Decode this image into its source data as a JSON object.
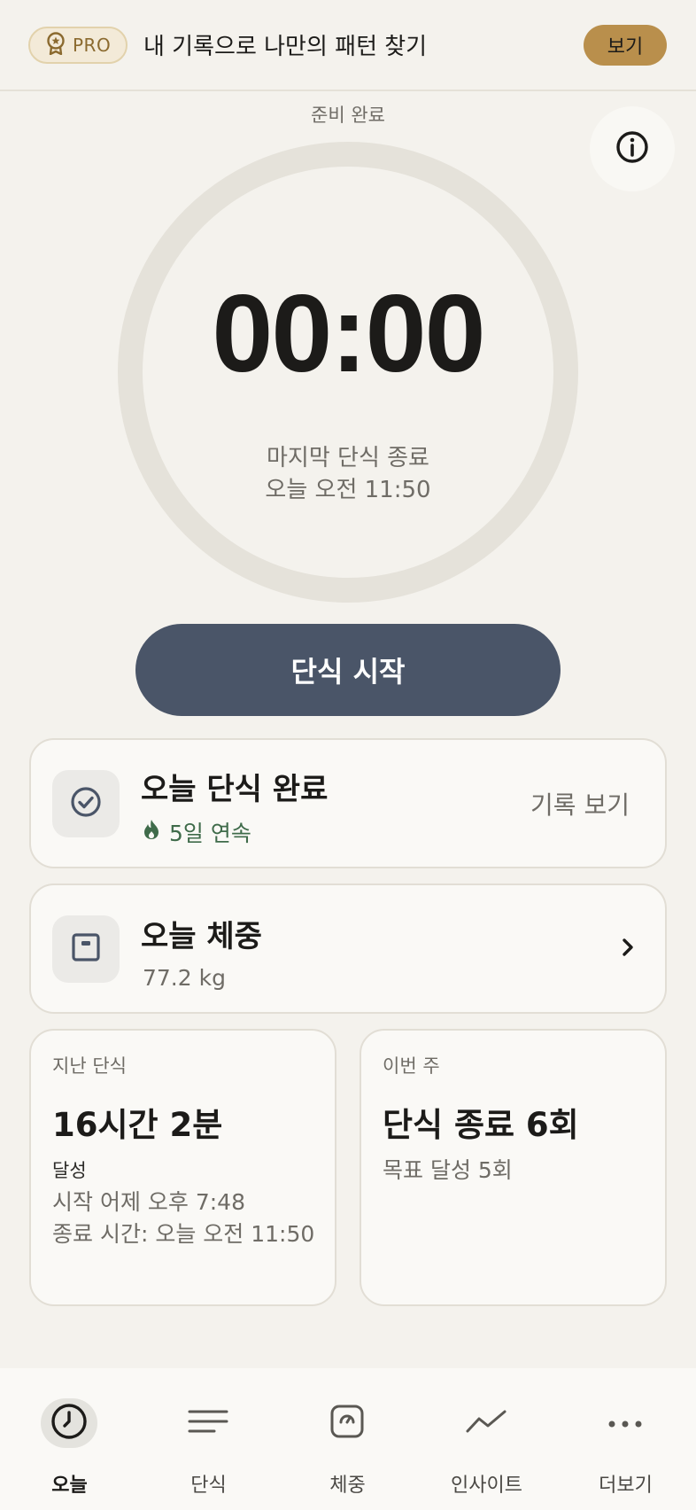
{
  "banner": {
    "pro_label": "PRO",
    "text": "내 기록으로 나만의 패턴 찾기",
    "view_label": "보기"
  },
  "timer": {
    "status": "준비 완료",
    "value": "00:00",
    "last_label": "마지막 단식 종료",
    "last_time": "오늘 오전 11:50",
    "start_label": "단식 시작"
  },
  "today_card": {
    "title": "오늘 단식 완료",
    "streak": "5일 연속",
    "history_label": "기록 보기"
  },
  "weight_card": {
    "title": "오늘 체중",
    "value": "77.2 kg"
  },
  "last_fast_card": {
    "label": "지난 단식",
    "value": "16시간 2분",
    "status": "달성",
    "start": "시작 어제 오후 7:48",
    "end": "종료 시간: 오늘 오전 11:50"
  },
  "week_card": {
    "label": "이번 주",
    "value": "단식 종료 6회",
    "goal": "목표 달성 5회"
  },
  "nav": [
    {
      "label": "오늘",
      "icon": "clock-icon",
      "active": true
    },
    {
      "label": "단식",
      "icon": "list-icon",
      "active": false
    },
    {
      "label": "체중",
      "icon": "scale-icon",
      "active": false
    },
    {
      "label": "인사이트",
      "icon": "trend-icon",
      "active": false
    },
    {
      "label": "더보기",
      "icon": "more-icon",
      "active": false
    }
  ],
  "colors": {
    "accent": "#b98f4c",
    "primary_button": "#4a5568",
    "streak": "#3f6b4a",
    "background": "#f4f2ed"
  }
}
